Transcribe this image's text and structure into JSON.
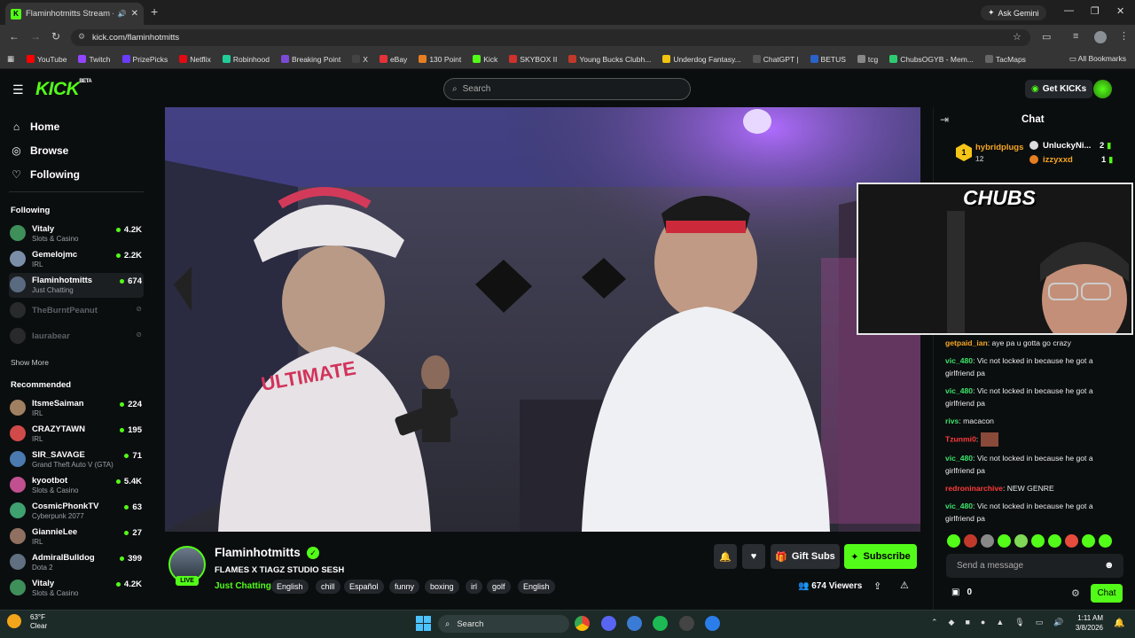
{
  "browser": {
    "tab_title": "Flaminhotmitts Stream - W",
    "new_tab": "+",
    "ask_gemini": "Ask Gemini",
    "url": "kick.com/flaminhotmitts",
    "all_bookmarks": "All Bookmarks",
    "bookmarks": [
      {
        "label": "YouTube",
        "color": "#ff0000"
      },
      {
        "label": "Twitch",
        "color": "#9146ff"
      },
      {
        "label": "PrizePicks",
        "color": "#6a3cff"
      },
      {
        "label": "Netflix",
        "color": "#e50914"
      },
      {
        "label": "Robinhood",
        "color": "#21ce99"
      },
      {
        "label": "Breaking Point",
        "color": "#7b4bd6"
      },
      {
        "label": "X",
        "color": "#444444"
      },
      {
        "label": "eBay",
        "color": "#e53238"
      },
      {
        "label": "130 Point",
        "color": "#e67e22"
      },
      {
        "label": "Kick",
        "color": "#53fc18"
      },
      {
        "label": "SKYBOX II",
        "color": "#d0312d"
      },
      {
        "label": "Young Bucks Clubh...",
        "color": "#c0392b"
      },
      {
        "label": "Underdog Fantasy...",
        "color": "#f1c40f"
      },
      {
        "label": "ChatGPT |",
        "color": "#555555"
      },
      {
        "label": "BETUS",
        "color": "#2a62c9"
      },
      {
        "label": "tcg",
        "color": "#888888"
      },
      {
        "label": "ChubsOGYB - Mem...",
        "color": "#2ecc71"
      },
      {
        "label": "TacMaps",
        "color": "#666666"
      }
    ]
  },
  "header": {
    "logo": "KICK",
    "logo_sup": "BETA",
    "search_placeholder": "Search",
    "get_kicks": "Get KICKs"
  },
  "sidebar": {
    "nav": [
      {
        "label": "Home",
        "icon": "home-icon"
      },
      {
        "label": "Browse",
        "icon": "compass-icon"
      },
      {
        "label": "Following",
        "icon": "heart-icon"
      }
    ],
    "following_heading": "Following",
    "following": [
      {
        "name": "Vitaly",
        "category": "Slots & Casino",
        "viewers": "4.2K",
        "live": true,
        "color": "#3f8f5a"
      },
      {
        "name": "Gemelojmc",
        "category": "IRL",
        "viewers": "2.2K",
        "live": true,
        "color": "#7a8ea8"
      },
      {
        "name": "Flaminhotmitts",
        "category": "Just Chatting",
        "viewers": "674",
        "live": true,
        "color": "#5a6a80"
      },
      {
        "name": "TheBurntPeanut",
        "category": "",
        "viewers": "",
        "live": false,
        "color": "#555555"
      },
      {
        "name": "laurabear",
        "category": "",
        "viewers": "",
        "live": false,
        "color": "#555555"
      }
    ],
    "show_more": "Show More",
    "recommended_heading": "Recommended",
    "recommended": [
      {
        "name": "ItsmeSaiman",
        "category": "IRL",
        "viewers": "224",
        "color": "#a08060"
      },
      {
        "name": "CRAZYTAWN",
        "category": "IRL",
        "viewers": "195",
        "color": "#d04a4a"
      },
      {
        "name": "SIR_SAVAGE",
        "category": "Grand Theft Auto V (GTA)",
        "viewers": "71",
        "color": "#4a7ab0"
      },
      {
        "name": "kyootbot",
        "category": "Slots & Casino",
        "viewers": "5.4K",
        "color": "#c05090"
      },
      {
        "name": "CosmicPhonkTV",
        "category": "Cyberpunk 2077",
        "viewers": "63",
        "color": "#3fa070"
      },
      {
        "name": "GiannieLee",
        "category": "IRL",
        "viewers": "27",
        "color": "#907060"
      },
      {
        "name": "AdmiralBulldog",
        "category": "Dota 2",
        "viewers": "399",
        "color": "#607080"
      },
      {
        "name": "Vitaly",
        "category": "Slots & Casino",
        "viewers": "4.2K",
        "color": "#3f8f5a"
      }
    ]
  },
  "stream": {
    "channel": "Flaminhotmitts",
    "live_badge": "LIVE",
    "title": "FLAMES X TIAGZ STUDIO SESH",
    "category": "Just Chatting",
    "tags": [
      "English",
      "chill",
      "Español",
      "funny",
      "boxing",
      "irl",
      "golf",
      "English"
    ],
    "gift_subs": "Gift Subs",
    "subscribe": "Subscribe",
    "viewers": "674 Viewers"
  },
  "chat": {
    "title": "Chat",
    "leaderboard": [
      {
        "rank": "1",
        "name": "hybridplugs",
        "count": "12",
        "color": "#f5a623"
      },
      {
        "name": "UnluckyNi...",
        "count": "2",
        "color": "#ffffff"
      },
      {
        "name": "izzyxxd",
        "count": "1",
        "color": "#f5a623"
      }
    ],
    "overlay_title": "CHUBS",
    "messages": [
      {
        "user": "getpaid_ian",
        "text": "aye pa u gotta go crazy",
        "color": "#f5a623"
      },
      {
        "user": "vic_480",
        "text": "Vic not locked in because he got a girlfriend pa",
        "color": "#3be26a"
      },
      {
        "user": "vic_480",
        "text": "Vic not locked in because he got a girlfriend pa",
        "color": "#3be26a"
      },
      {
        "user": "rivs",
        "text": "macacon",
        "color": "#3be26a"
      },
      {
        "user": "Tzunmi0",
        "text": "",
        "color": "#ff3b3b"
      },
      {
        "user": "vic_480",
        "text": "Vic not locked in because he got a girlfriend pa",
        "color": "#3be26a"
      },
      {
        "user": "redroninarchive",
        "text": "NEW GENRE",
        "color": "#ff3b3b"
      },
      {
        "user": "vic_480",
        "text": "Vic not locked in because he got a girlfriend pa",
        "color": "#3be26a"
      }
    ],
    "send_placeholder": "Send a message",
    "points": "0",
    "chat_button": "Chat"
  },
  "taskbar": {
    "temp": "63°F",
    "weather": "Clear",
    "search": "Search",
    "time": "1:11 AM",
    "date": "3/8/2026"
  }
}
